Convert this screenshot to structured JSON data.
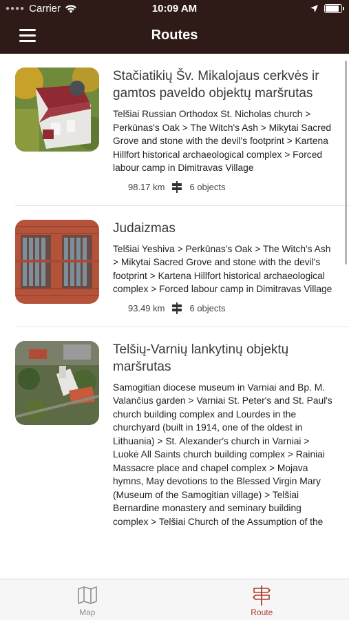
{
  "status_bar": {
    "carrier": "Carrier",
    "time": "10:09 AM"
  },
  "header": {
    "title": "Routes"
  },
  "routes": [
    {
      "title": "Stačiatikių Šv. Mikalojaus cerkvės ir gamtos paveldo objektų maršrutas",
      "description": "Telšiai Russian Orthodox St. Nicholas church > Perkūnas's Oak > The Witch's Ash > Mikytai Sacred Grove and stone with the devil's footprint  > Kartena Hillfort historical archaeological complex > Forced labour camp in Dimitravas Village",
      "distance": "98.17 km",
      "objects": "6 objects"
    },
    {
      "title": "Judaizmas",
      "description": "Telšiai Yeshiva > Perkūnas's Oak > The Witch's Ash > Mikytai Sacred Grove and stone with the devil's footprint  > Kartena Hillfort historical archaeological complex > Forced labour camp in Dimitravas Village",
      "distance": "93.49 km",
      "objects": "6 objects"
    },
    {
      "title": "Telšių-Varnių lankytinų objektų maršrutas",
      "description": "Samogitian diocese museum in Varniai and Bp. M. Valančius garden > Varniai St. Peter's and St. Paul's church building complex and Lourdes in the churchyard (built in 1914, one of the oldest in Lithuania) > St. Alexander's church in Varniai > Luokė All Saints church building complex > Rainiai Massacre place and chapel complex > Mojava hymns, May devotions to the Blessed Virgin Mary (Museum of the Samogitian village) > Telšiai Bernardine monastery and seminary building complex > Telšiai Church of the Assumption of the"
    }
  ],
  "tabs": [
    {
      "label": "Map",
      "icon": "map-icon",
      "active": false
    },
    {
      "label": "Route",
      "icon": "signpost-icon",
      "active": true
    }
  ],
  "colors": {
    "header_bg": "#2e1b17",
    "accent": "#b03a2e",
    "tab_inactive": "#8e8e8e"
  }
}
